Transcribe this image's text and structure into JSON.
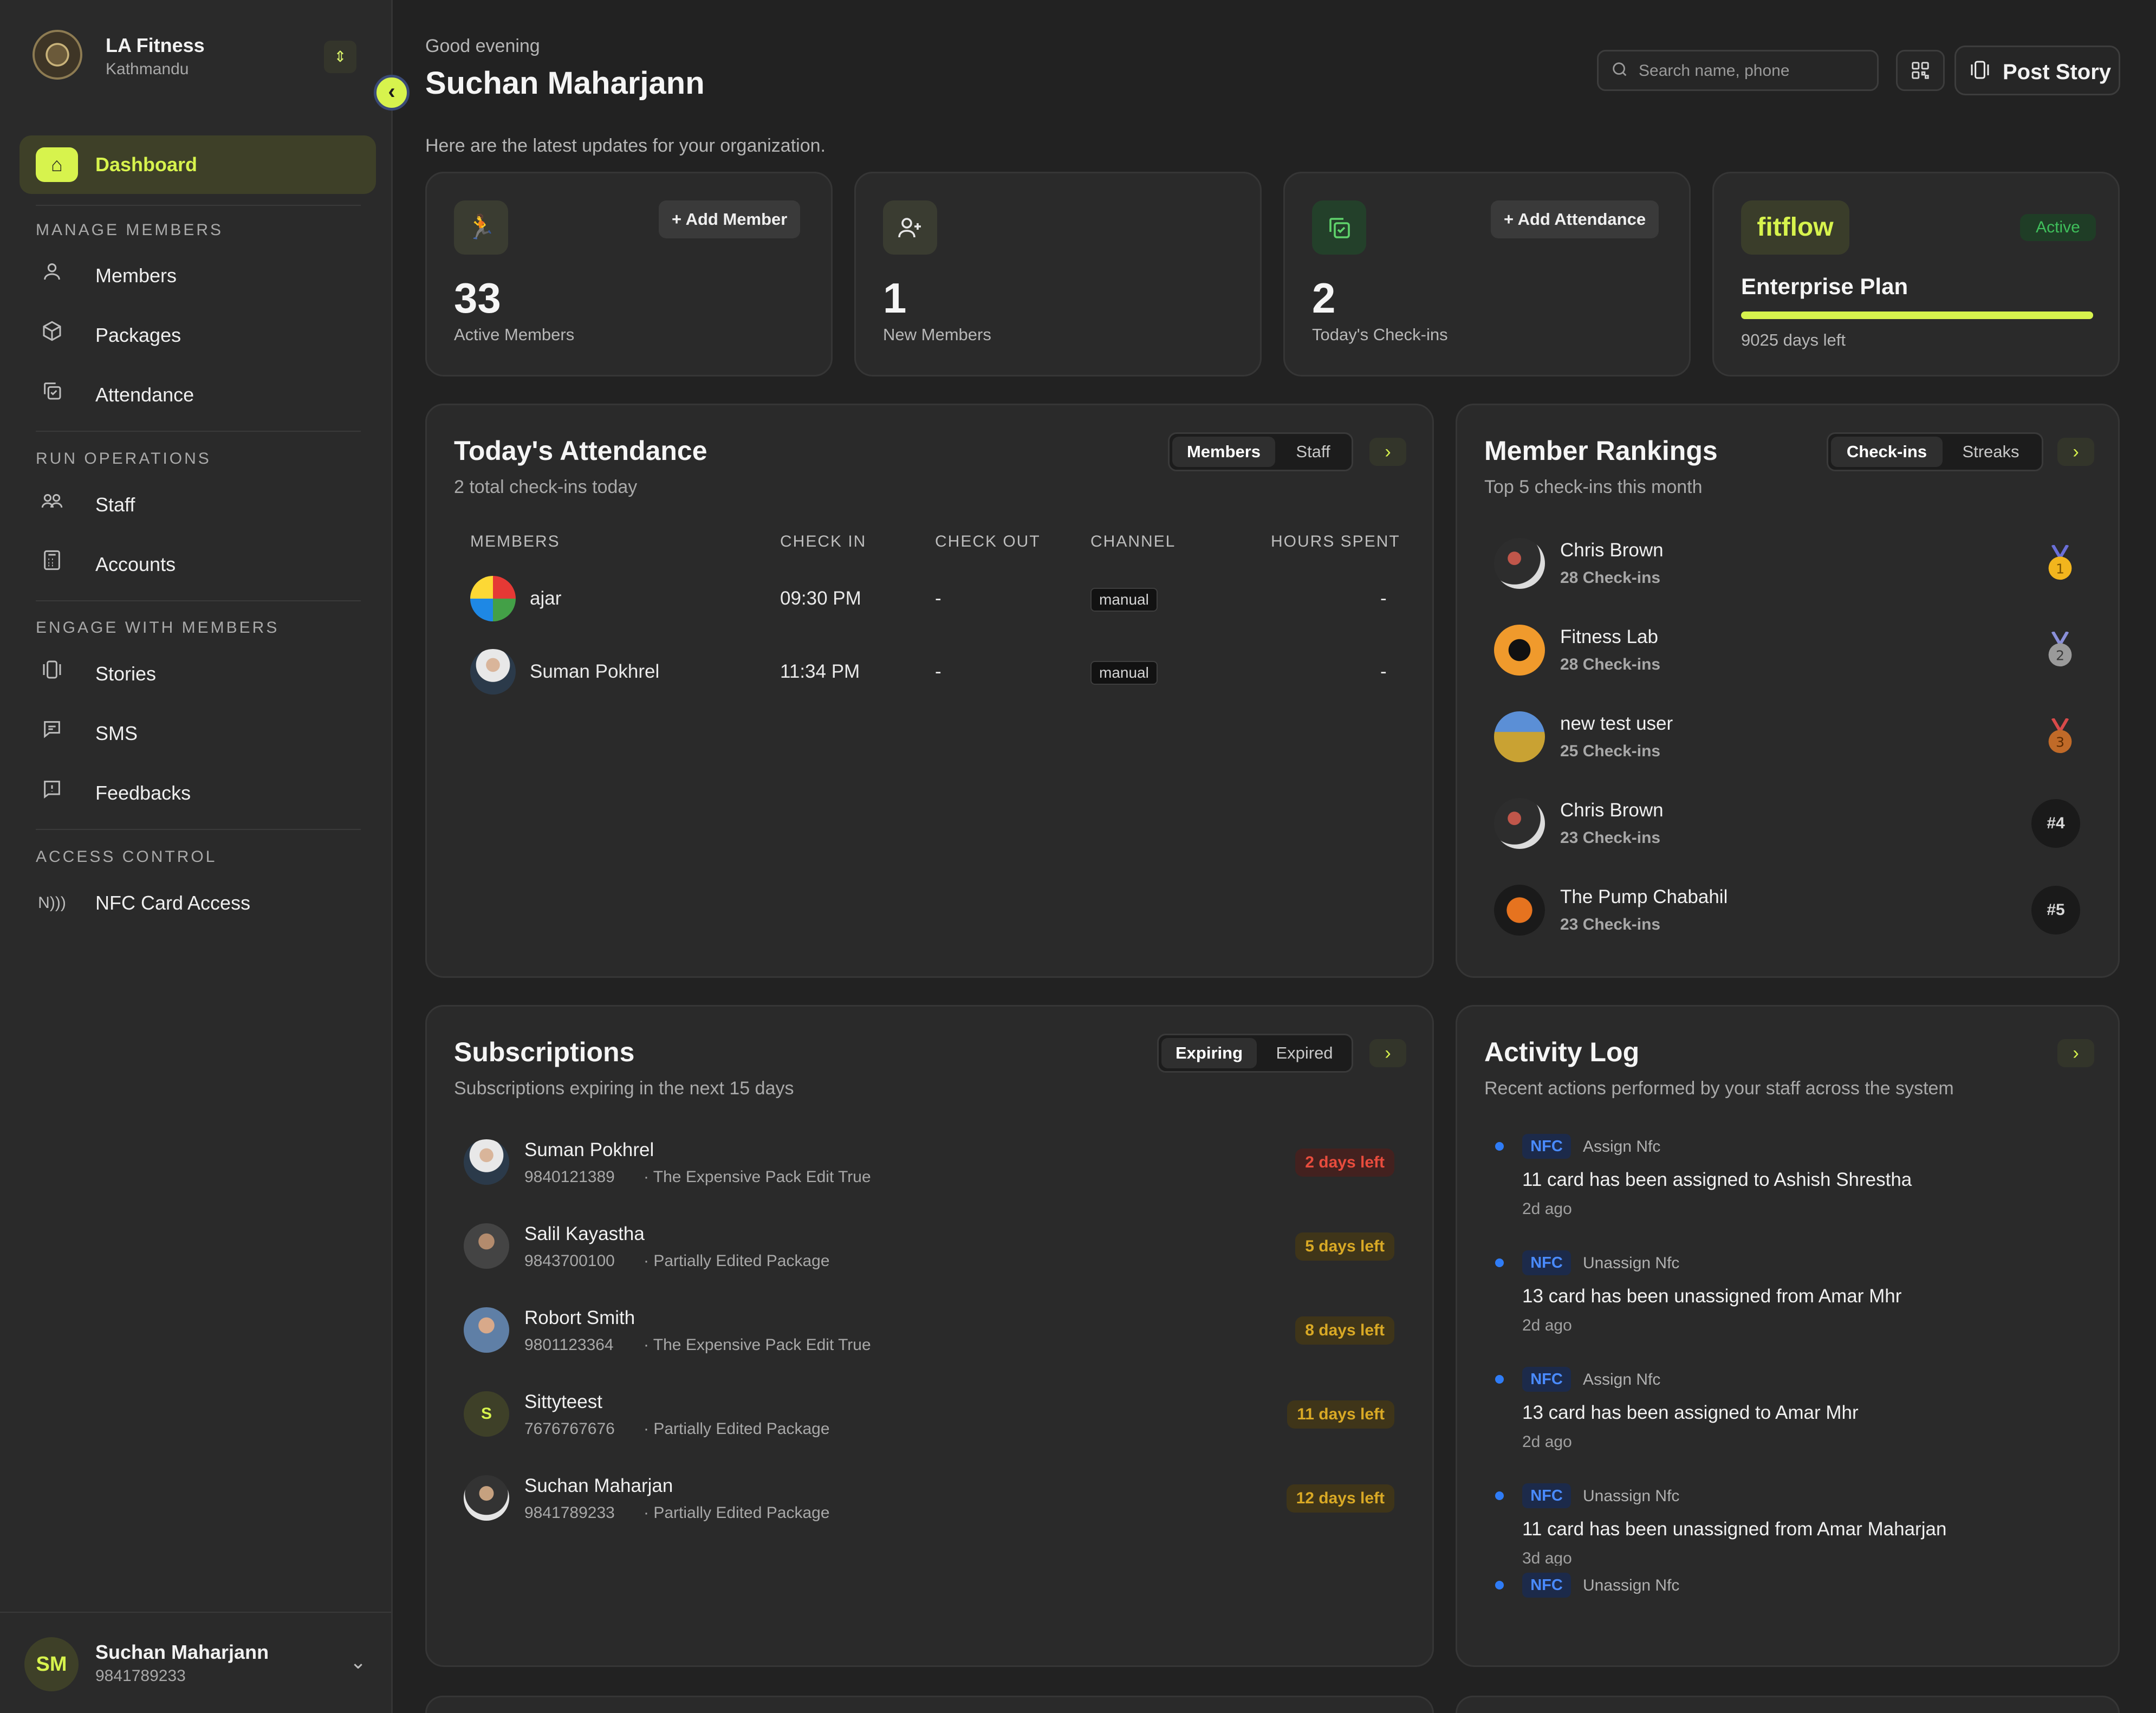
{
  "org": {
    "name": "LA Fitness",
    "city": "Kathmandu"
  },
  "sidebar": {
    "dashboard": "Dashboard",
    "sections": {
      "manage": "MANAGE MEMBERS",
      "run": "RUN OPERATIONS",
      "engage": "ENGAGE WITH MEMBERS",
      "access": "ACCESS CONTROL"
    },
    "items": {
      "members": "Members",
      "packages": "Packages",
      "attendance": "Attendance",
      "staff": "Staff",
      "accounts": "Accounts",
      "stories": "Stories",
      "sms": "SMS",
      "feedbacks": "Feedbacks",
      "nfc": "NFC Card Access"
    },
    "user": {
      "initials": "SM",
      "name": "Suchan Maharjann",
      "phone": "9841789233"
    }
  },
  "header": {
    "greeting": "Good evening",
    "title": "Suchan Maharjann",
    "subtitle": "Here are the latest updates for your organization.",
    "search_placeholder": "Search name, phone",
    "post_story": "Post Story"
  },
  "stats": {
    "active": {
      "value": "33",
      "label": "Active Members",
      "action": "+ Add Member"
    },
    "new": {
      "value": "1",
      "label": "New Members"
    },
    "checkins": {
      "value": "2",
      "label": "Today's Check-ins",
      "action": "+ Add Attendance"
    }
  },
  "plan": {
    "brand": "fitflow",
    "status": "Active",
    "name": "Enterprise Plan",
    "progress": 1.0,
    "days_left": "9025 days left"
  },
  "attendance": {
    "title": "Today's Attendance",
    "subtitle": "2 total check-ins today",
    "tabs": [
      "Members",
      "Staff"
    ],
    "columns": [
      "MEMBERS",
      "CHECK IN",
      "CHECK OUT",
      "CHANNEL",
      "HOURS SPENT"
    ],
    "rows": [
      {
        "name": "ajar",
        "check_in": "09:30 PM",
        "check_out": "-",
        "channel": "manual",
        "hours": "-"
      },
      {
        "name": "Suman Pokhrel",
        "check_in": "11:34 PM",
        "check_out": "-",
        "channel": "manual",
        "hours": "-"
      }
    ]
  },
  "rankings": {
    "title": "Member Rankings",
    "subtitle": "Top 5 check-ins this month",
    "tabs": [
      "Check-ins",
      "Streaks"
    ],
    "items": [
      {
        "name": "Chris Brown",
        "count": "28 Check-ins",
        "rank": "1"
      },
      {
        "name": "Fitness Lab",
        "count": "28 Check-ins",
        "rank": "2"
      },
      {
        "name": "new test user",
        "count": "25 Check-ins",
        "rank": "3"
      },
      {
        "name": "Chris Brown",
        "count": "23 Check-ins",
        "rank": "#4"
      },
      {
        "name": "The Pump Chabahil",
        "count": "23 Check-ins",
        "rank": "#5"
      }
    ]
  },
  "subscriptions": {
    "title": "Subscriptions",
    "subtitle": "Subscriptions expiring in the next 15 days",
    "tabs": [
      "Expiring",
      "Expired"
    ],
    "items": [
      {
        "name": "Suman Pokhrel",
        "phone": "9840121389",
        "package": "· The Expensive Pack Edit True",
        "days": "2 days left"
      },
      {
        "name": "Salil Kayastha",
        "phone": "9843700100",
        "package": "· Partially Edited Package",
        "days": "5 days left"
      },
      {
        "name": "Robort Smith",
        "phone": "9801123364",
        "package": "· The Expensive Pack Edit True",
        "days": "8 days left"
      },
      {
        "name": "Sittyteest",
        "phone": "7676767676",
        "package": "· Partially Edited Package",
        "days": "11 days left",
        "initial": "S"
      },
      {
        "name": "Suchan Maharjan",
        "phone": "9841789233",
        "package": "· Partially Edited Package",
        "days": "12 days left"
      }
    ]
  },
  "activity": {
    "title": "Activity Log",
    "subtitle": "Recent actions performed by your staff across the system",
    "items": [
      {
        "tag": "NFC",
        "type": "Assign Nfc",
        "text": "11 card has been assigned to Ashish Shrestha",
        "time": "2d ago"
      },
      {
        "tag": "NFC",
        "type": "Unassign Nfc",
        "text": "13 card has been unassigned from Amar Mhr",
        "time": "2d ago"
      },
      {
        "tag": "NFC",
        "type": "Assign Nfc",
        "text": "13 card has been assigned to Amar Mhr",
        "time": "2d ago"
      },
      {
        "tag": "NFC",
        "type": "Unassign Nfc",
        "text": "11 card has been unassigned from Amar Maharjan",
        "time": "3d ago"
      },
      {
        "tag": "NFC",
        "type": "Unassign Nfc",
        "text": ""
      }
    ]
  },
  "colors": {
    "accent": "#d7f34d",
    "danger": "#e84c3d",
    "warning": "#d9a925",
    "info": "#2f7cf6"
  }
}
